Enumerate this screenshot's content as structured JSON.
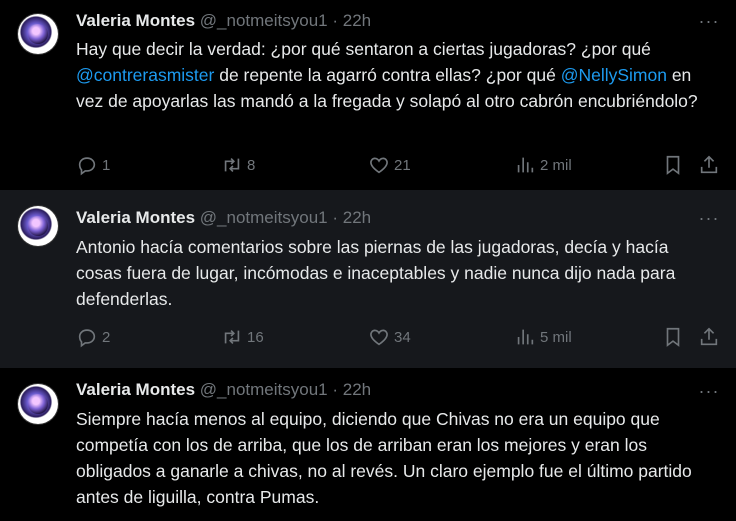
{
  "tweets": [
    {
      "author_name": "Valeria Montes",
      "handle": "@_notmeitsyou1",
      "dot": "·",
      "time": "22h",
      "more": "···",
      "text_parts": [
        "Hay que decir la verdad: ¿por qué sentaron a ciertas jugadoras? ¿por qué ",
        "@contrerasmister",
        " de repente la agarró contra ellas? ¿por qué ",
        "@NellySimon",
        " en vez de apoyarlas las mandó a la fregada y solapó al otro cabrón encubriéndolo?"
      ],
      "stats": {
        "replies": "1",
        "reposts": "8",
        "likes": "21",
        "views": "2 mil"
      }
    },
    {
      "author_name": "Valeria Montes",
      "handle": "@_notmeitsyou1",
      "dot": "·",
      "time": "22h",
      "more": "···",
      "text": "Antonio hacía comentarios sobre las piernas de las jugadoras, decía y hacía cosas fuera de lugar, incómodas e inaceptables y nadie nunca dijo nada para defenderlas.",
      "stats": {
        "replies": "2",
        "reposts": "16",
        "likes": "34",
        "views": "5 mil"
      }
    },
    {
      "author_name": "Valeria Montes",
      "handle": "@_notmeitsyou1",
      "dot": "·",
      "time": "22h",
      "more": "···",
      "text": "Siempre hacía menos al equipo, diciendo que Chivas no era un equipo que competía con los de arriba, que los de arriban eran los mejores y eran los obligados a ganarle a chivas, no al revés. Un claro ejemplo fue el último partido antes de liguilla, contra Pumas."
    }
  ],
  "colors": {
    "background": "#000000",
    "hover_background": "#16181c",
    "text": "#e7e9ea",
    "muted": "#71767b",
    "mention": "#1d9bf0"
  }
}
